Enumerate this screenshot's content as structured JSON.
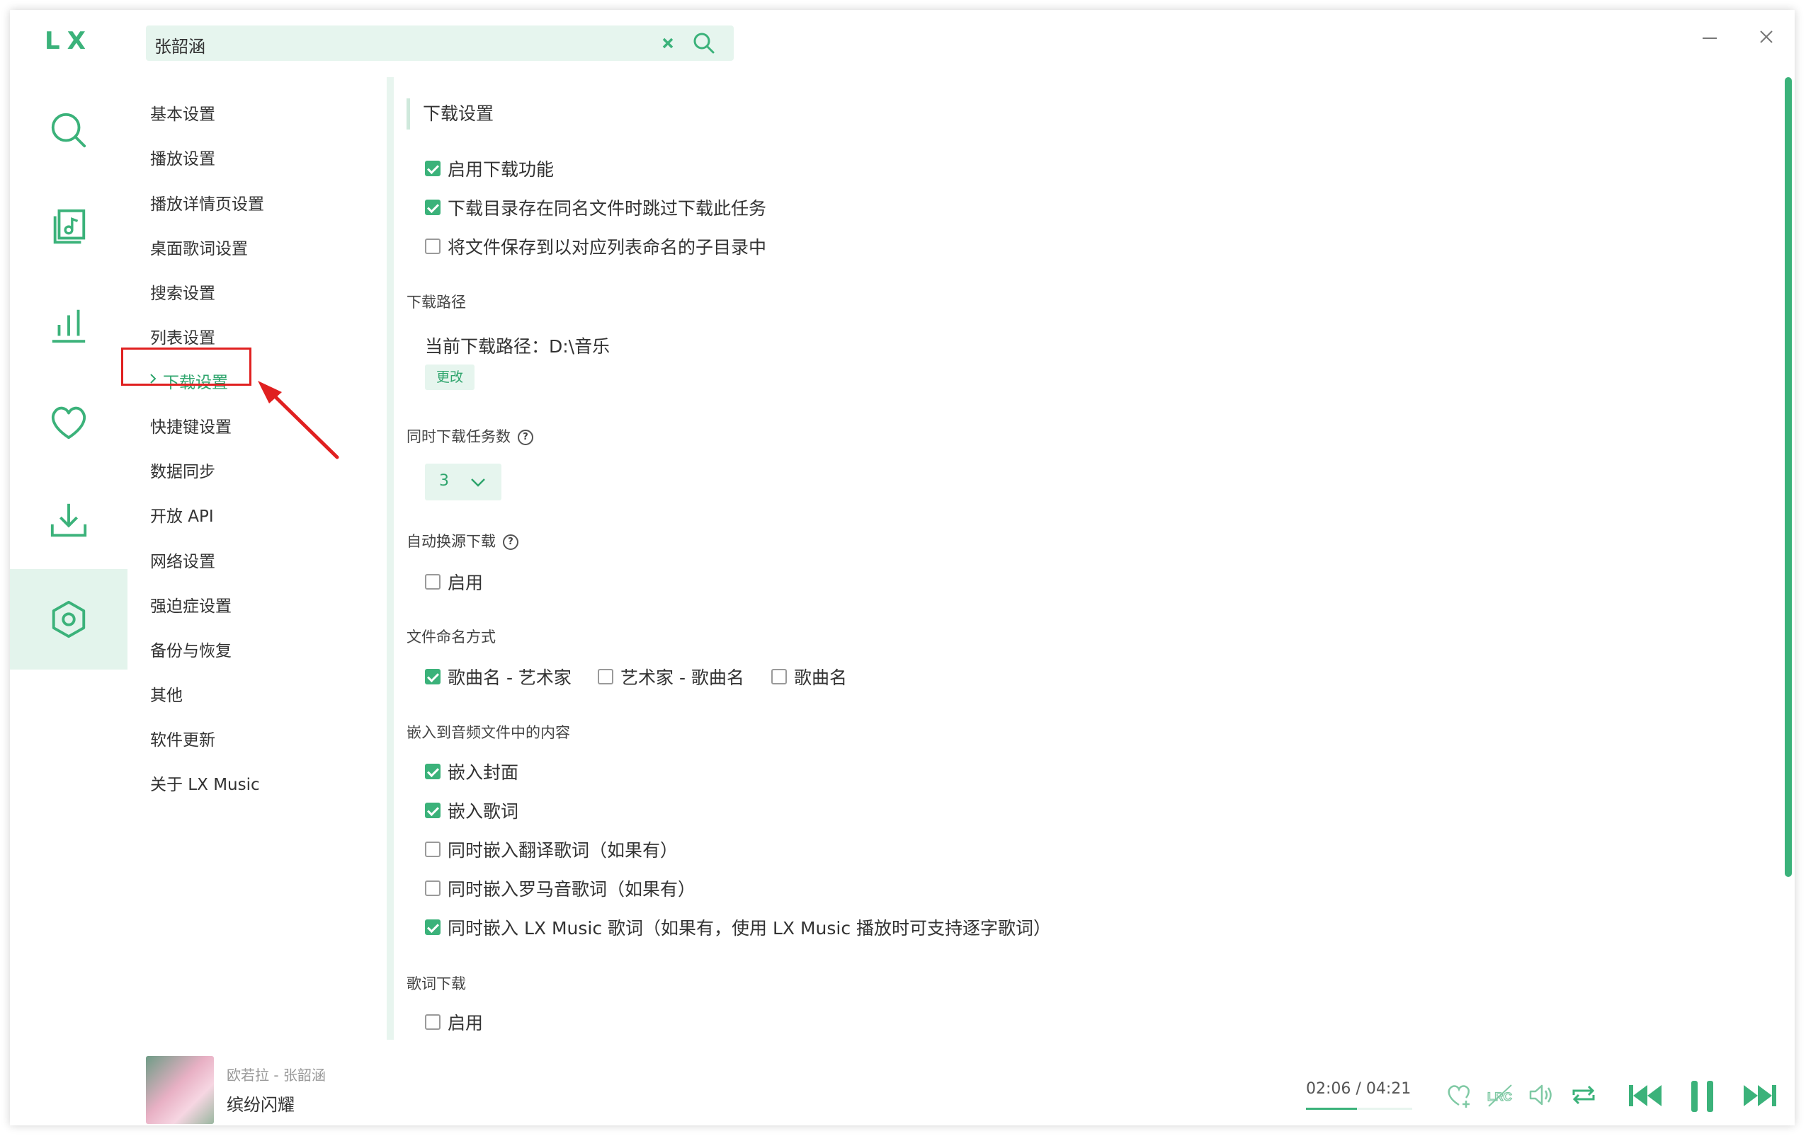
{
  "app": {
    "logo": "LX"
  },
  "search": {
    "value": "张韶涵"
  },
  "sidebar_nav": [
    "search-icon",
    "song-list-icon",
    "leaderboard-icon",
    "favorite-icon",
    "download-icon",
    "settings-icon"
  ],
  "settings_nav": {
    "items": [
      "基本设置",
      "播放设置",
      "播放详情页设置",
      "桌面歌词设置",
      "搜索设置",
      "列表设置",
      "下载设置",
      "快捷键设置",
      "数据同步",
      "开放 API",
      "网络设置",
      "强迫症设置",
      "备份与恢复",
      "其他",
      "软件更新",
      "关于 LX Music"
    ],
    "active_index": 6
  },
  "download": {
    "section_title": "下载设置",
    "options": [
      {
        "label": "启用下载功能",
        "checked": true
      },
      {
        "label": "下载目录存在同名文件时跳过下载此任务",
        "checked": true
      },
      {
        "label": "将文件保存到以对应列表命名的子目录中",
        "checked": false
      }
    ],
    "path_title": "下载路径",
    "path_text": "当前下载路径：D:\\音乐",
    "change_label": "更改",
    "concurrent_title": "同时下载任务数",
    "concurrent_value": "3",
    "auto_source_title": "自动换源下载",
    "auto_source_enable": {
      "label": "启用",
      "checked": false
    },
    "naming_title": "文件命名方式",
    "naming_options": [
      {
        "label": "歌曲名 - 艺术家",
        "checked": true
      },
      {
        "label": "艺术家 - 歌曲名",
        "checked": false
      },
      {
        "label": "歌曲名",
        "checked": false
      }
    ],
    "embed_title": "嵌入到音频文件中的内容",
    "embed_options": [
      {
        "label": "嵌入封面",
        "checked": true
      },
      {
        "label": "嵌入歌词",
        "checked": true
      },
      {
        "label": "同时嵌入翻译歌词（如果有）",
        "checked": false
      },
      {
        "label": "同时嵌入罗马音歌词（如果有）",
        "checked": false
      },
      {
        "label": "同时嵌入 LX Music 歌词（如果有，使用 LX Music 播放时可支持逐字歌词）",
        "checked": true
      }
    ],
    "lyric_title": "歌词下载",
    "lyric_enable": {
      "label": "启用",
      "checked": false
    }
  },
  "player": {
    "artist_line": "欧若拉 - 张韶涵",
    "song_name": "缤纷闪耀",
    "current_time": "02:06",
    "separator": "/",
    "total_time": "04:21",
    "progress": 0.48
  },
  "colors": {
    "accent": "#3bb27a",
    "accent_light": "#e6f5ee",
    "highlight_red": "#e02020"
  }
}
